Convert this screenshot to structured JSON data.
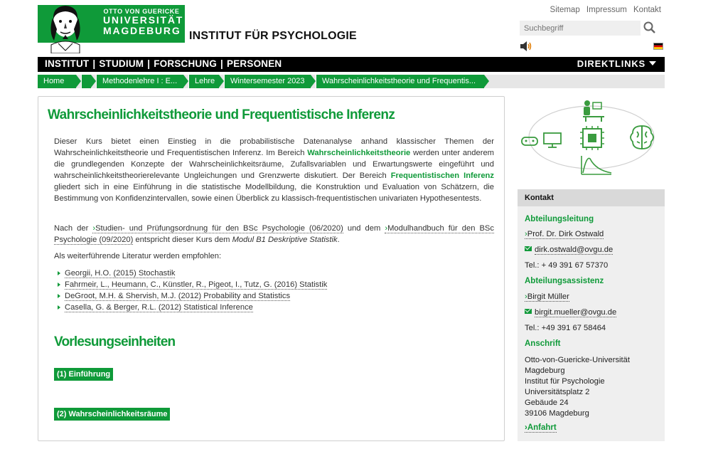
{
  "header": {
    "logo": {
      "line1": "OTTO VON GUERICKE",
      "line2": "UNIVERSITÄT",
      "line3": "MAGDEBURG"
    },
    "institute_title": "INSTITUT FÜR PSYCHOLOGIE",
    "top_links": [
      "Sitemap",
      "Impressum",
      "Kontakt"
    ],
    "search": {
      "placeholder": "Suchbegriff"
    }
  },
  "nav": {
    "items": [
      "INSTITUT",
      "STUDIUM",
      "FORSCHUNG",
      "PERSONEN"
    ],
    "direktlinks": "DIREKTLINKS"
  },
  "breadcrumb": [
    "Home",
    "",
    "Methodenlehre I : E...",
    "Lehre",
    "Wintersemester 2023",
    "Wahrscheinlichkeitstheorie und Frequentis..."
  ],
  "main": {
    "title": "Wahrscheinlichkeitstheorie und Frequentistische Inferenz",
    "p1": {
      "a": "Dieser Kurs bietet einen Einstieg in die probabilistische Datenanalyse anhand klassischer Themen der Wahrscheinlichkeitstheorie und Frequentistischen Inferenz. Im Bereich ",
      "hl1": "Wahrscheinlichkeitstheorie",
      "b": " werden unter anderem die grundlegenden Konzepte der Wahrscheinlichkeitsräume, Zufallsvariablen und Erwartungswerte eingeführt und wahrscheinlichkeitstheorierelevante Ungleichungen und Grenzwerte diskutiert. Der Bereich ",
      "hl2": "Frequentistischen Inferenz",
      "c": " gliedert sich in eine Einführung in die statistische Modellbildung, die Konstruktion und Evaluation von Schätzern, die Bestimmung von Konfidenzintervallen, sowie einen Überblick zu klassisch-frequentistischen univariaten Hypothesentests."
    },
    "p2": {
      "a": "Nach der ",
      "link1": "Studien- und Prüfungsordnung für den BSc Psychologie (06/2020)",
      "b": " und dem ",
      "link2": "Modulhandbuch für den BSc Psychologie (09/2020)",
      "c": " entspricht dieser Kurs dem ",
      "em": "Modul B1 Deskriptive Statistik",
      "d": "."
    },
    "p3": "Als weiterführende Literatur werden empfohlen:",
    "literature": [
      "Georgii, H.O. (2015) Stochastik",
      "Fahrmeir, L., Heumann, C., Künstler, R., Pigeot, I., Tutz, G. (2016) Statistik",
      "DeGroot, M.H. & Shervish, M.J. (2012) Probability and Statistics",
      "Casella, G. & Berger, R.L. (2012) Statistical Inference"
    ],
    "section_title": "Vorlesungseinheiten",
    "units": [
      "(1) Einführung",
      "(2) Wahrscheinlichkeitsräume"
    ]
  },
  "sidebar": {
    "kontakt_title": "Kontakt",
    "leitung_label": "Abteilungsleitung",
    "leitung_name": "Prof. Dr. Dirk Ostwald",
    "leitung_email": "dirk.ostwald@ovgu.de",
    "leitung_tel": "Tel.: + 49 391 67 57370",
    "assistenz_label": "Abteilungsassistenz",
    "assistenz_name": "Birgit Müller",
    "assistenz_email": "birgit.mueller@ovgu.de",
    "assistenz_tel": "Tel.: +49 391 67 58464",
    "anschrift_label": "Anschrift",
    "address": [
      "Otto-von-Guericke-Universität",
      "Magdeburg",
      "Institut für Psychologie",
      "Universitätsplatz 2",
      "Gebäude 24",
      "39106 Magdeburg"
    ],
    "anfahrt": "Anfahrt"
  },
  "colors": {
    "brand_green": "#0f9a39",
    "nav_black": "#000000",
    "sidebar_bg": "#efefef"
  }
}
